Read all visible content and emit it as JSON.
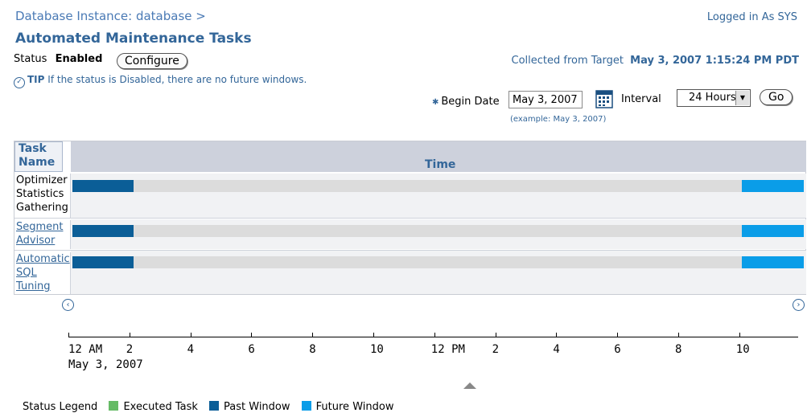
{
  "header": {
    "breadcrumb": "Database Instance: database  >",
    "logged_in": "Logged in As SYS",
    "title": "Automated Maintenance Tasks"
  },
  "status": {
    "label": "Status",
    "value": "Enabled",
    "configure_label": "Configure",
    "collected_label": "Collected from Target",
    "collected_value": "May 3, 2007 1:15:24 PM PDT"
  },
  "tip": {
    "label": "TIP",
    "text": "If the status is Disabled, there are no future windows."
  },
  "filters": {
    "begin_date_label": "Begin Date",
    "begin_date_value": "May 3, 2007",
    "example": "(example: May 3, 2007)",
    "interval_label": "Interval",
    "interval_value": "24 Hours",
    "go_label": "Go"
  },
  "grid": {
    "col_task": "Task Name",
    "col_time": "Time",
    "rows": [
      {
        "name": "Optimizer Statistics Gathering",
        "link": false
      },
      {
        "name": "Segment Advisor",
        "link": true
      },
      {
        "name": "Automatic SQL Tuning",
        "link": true
      }
    ]
  },
  "axis": {
    "ticks": [
      "12 AM",
      "2",
      "4",
      "6",
      "8",
      "10",
      "12 PM",
      "2",
      "4",
      "6",
      "8",
      "10"
    ],
    "date": "May 3, 2007"
  },
  "legend": {
    "label": "Status Legend",
    "items": [
      {
        "label": "Executed Task",
        "color": "#66bb66"
      },
      {
        "label": "Past Window",
        "color": "#0b5e97"
      },
      {
        "label": "Future Window",
        "color": "#0a9de8"
      }
    ]
  },
  "colors": {
    "accent": "#336699",
    "past": "#0b5e97",
    "future": "#0a9de8"
  }
}
